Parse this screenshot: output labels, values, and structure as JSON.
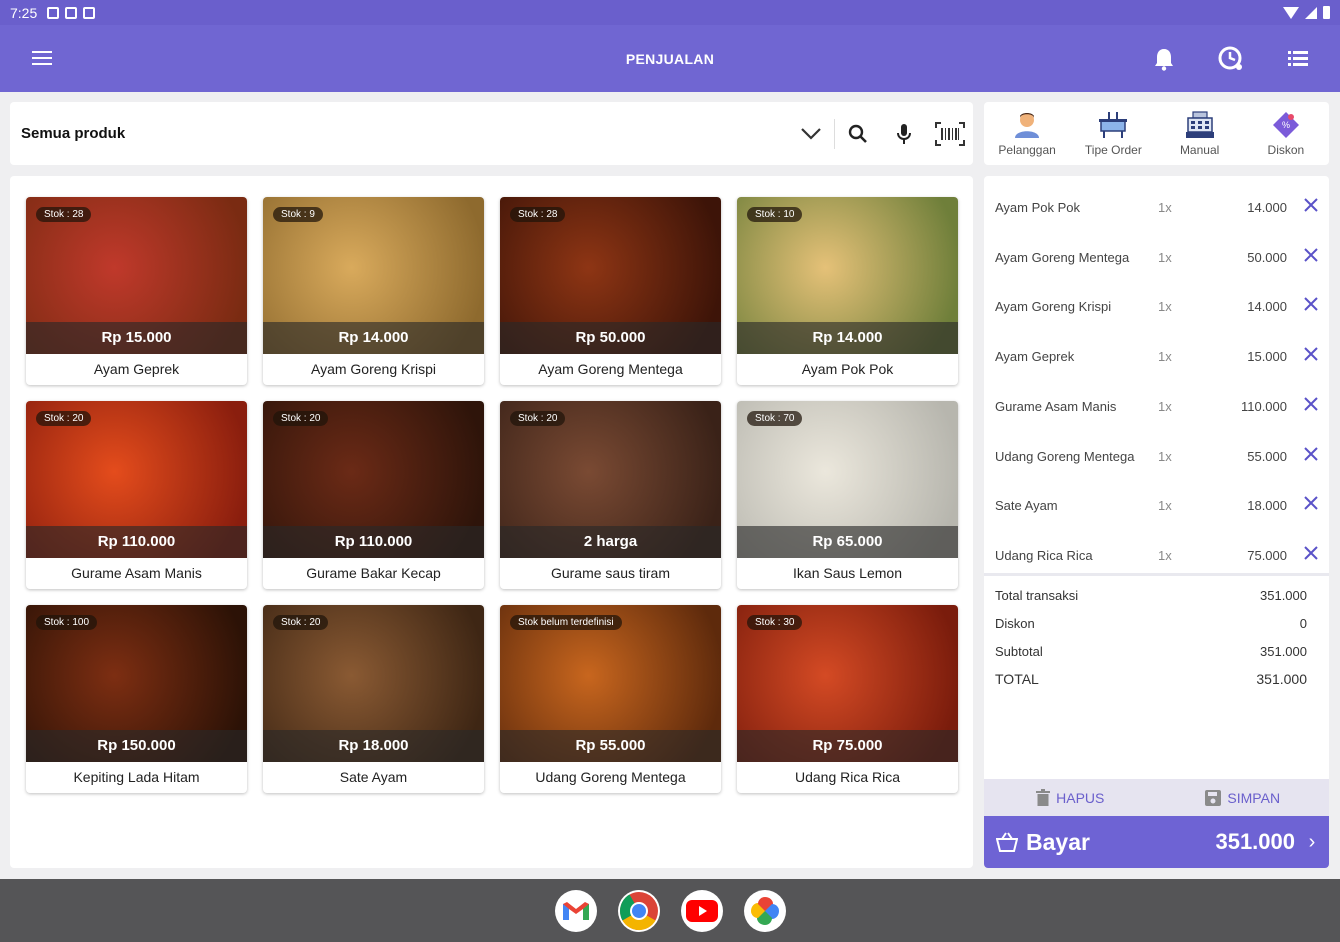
{
  "status": {
    "time": "7:25"
  },
  "appbar": {
    "title": "PENJUALAN"
  },
  "filter": {
    "label": "Semua produk"
  },
  "actions": [
    {
      "label": "Pelanggan",
      "icon": "customer-icon"
    },
    {
      "label": "Tipe Order",
      "icon": "order-type-icon"
    },
    {
      "label": "Manual",
      "icon": "cash-register-icon"
    },
    {
      "label": "Diskon",
      "icon": "discount-tag-icon"
    }
  ],
  "products": [
    {
      "stock": "Stok : 28",
      "price": "Rp 15.000",
      "name": "Ayam Geprek",
      "colors": [
        "#c0392b",
        "#7a2b12"
      ]
    },
    {
      "stock": "Stok : 9",
      "price": "Rp 14.000",
      "name": "Ayam Goreng Krispi",
      "colors": [
        "#d9aa5c",
        "#8e6a2e"
      ]
    },
    {
      "stock": "Stok : 28",
      "price": "Rp 50.000",
      "name": "Ayam Goreng Mentega",
      "colors": [
        "#8e3514",
        "#3d1408"
      ]
    },
    {
      "stock": "Stok : 10",
      "price": "Rp 14.000",
      "name": "Ayam Pok Pok",
      "colors": [
        "#e5c178",
        "#6f7f3a"
      ]
    },
    {
      "stock": "Stok : 20",
      "price": "Rp 110.000",
      "name": "Gurame Asam Manis",
      "colors": [
        "#e44c1c",
        "#8a1e0e"
      ]
    },
    {
      "stock": "Stok : 20",
      "price": "Rp 110.000",
      "name": "Gurame Bakar Kecap",
      "colors": [
        "#6b2a16",
        "#2e140a"
      ]
    },
    {
      "stock": "Stok : 20",
      "price": "2 harga",
      "name": "Gurame saus tiram",
      "colors": [
        "#7a4a33",
        "#3a2218"
      ]
    },
    {
      "stock": "Stok : 70",
      "price": "Rp 65.000",
      "name": "Ikan Saus Lemon",
      "colors": [
        "#ebe7dc",
        "#b7b6ae"
      ]
    },
    {
      "stock": "Stok : 100",
      "price": "Rp 150.000",
      "name": "Kepiting Lada Hitam",
      "colors": [
        "#7d2e12",
        "#2c1206"
      ]
    },
    {
      "stock": "Stok : 20",
      "price": "Rp 18.000",
      "name": "Sate Ayam",
      "colors": [
        "#8a5a33",
        "#3e2614"
      ]
    },
    {
      "stock": "Stok belum terdefinisi",
      "price": "Rp 55.000",
      "name": "Udang Goreng Mentega",
      "colors": [
        "#c8661e",
        "#5e2a0c"
      ]
    },
    {
      "stock": "Stok : 30",
      "price": "Rp 75.000",
      "name": "Udang Rica Rica",
      "colors": [
        "#d44a24",
        "#7a1c0c"
      ]
    }
  ],
  "order": {
    "items": [
      {
        "name": "Ayam Pok Pok",
        "qty": "1x",
        "price": "14.000"
      },
      {
        "name": "Ayam Goreng Mentega",
        "qty": "1x",
        "price": "50.000"
      },
      {
        "name": "Ayam Goreng Krispi",
        "qty": "1x",
        "price": "14.000"
      },
      {
        "name": "Ayam Geprek",
        "qty": "1x",
        "price": "15.000"
      },
      {
        "name": "Gurame Asam Manis",
        "qty": "1x",
        "price": "110.000"
      },
      {
        "name": "Udang Goreng Mentega",
        "qty": "1x",
        "price": "55.000"
      },
      {
        "name": "Sate Ayam",
        "qty": "1x",
        "price": "18.000"
      },
      {
        "name": "Udang Rica Rica",
        "qty": "1x",
        "price": "75.000"
      }
    ],
    "totals": {
      "total_transaksi_label": "Total transaksi",
      "total_transaksi": "351.000",
      "diskon_label": "Diskon",
      "diskon": "0",
      "subtotal_label": "Subtotal",
      "subtotal": "351.000",
      "total_label": "TOTAL",
      "total": "351.000"
    }
  },
  "buttons": {
    "delete_label": "HAPUS",
    "save_label": "SIMPAN"
  },
  "pay": {
    "label": "Bayar",
    "amount": "351.000"
  },
  "colors": {
    "primary": "#7066d2",
    "status": "#6a5fcc",
    "remove": "#5a52c8"
  },
  "dock": [
    "gmail-icon",
    "chrome-icon",
    "youtube-icon",
    "photos-icon"
  ]
}
